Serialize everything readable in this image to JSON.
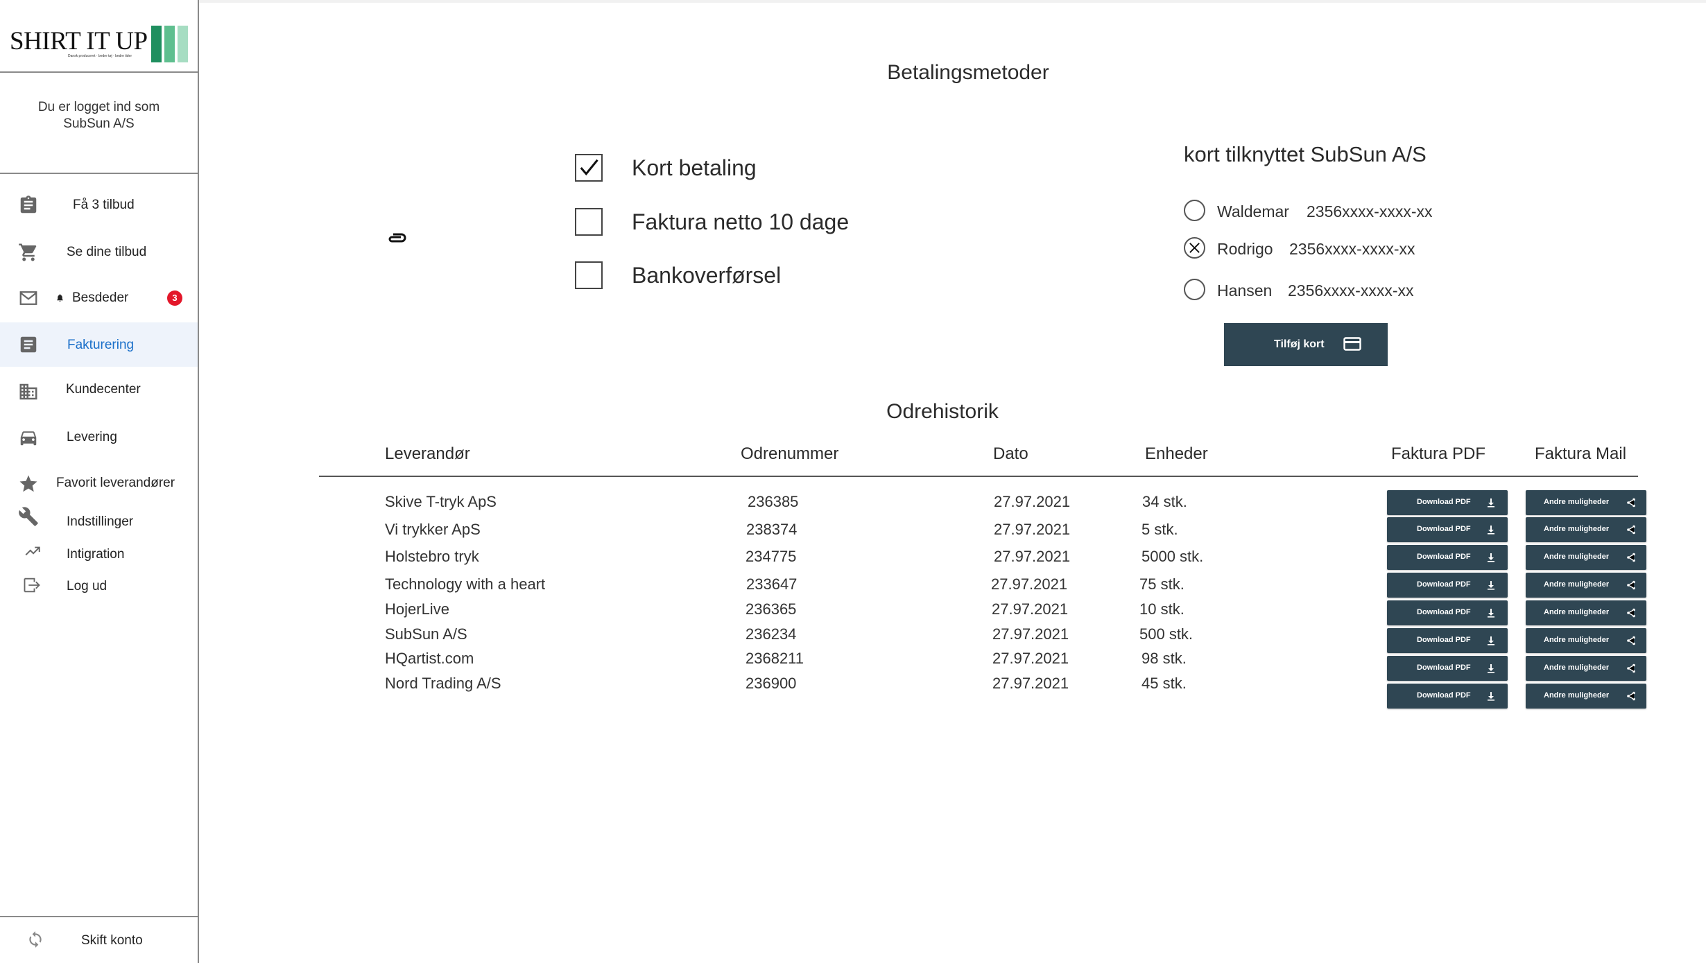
{
  "brand": {
    "name": "SHIRT IT UP",
    "tagline": "Dansk produceret · bedre tøj · bedre tider",
    "colors": [
      "#1f8f5f",
      "#5fbf8f",
      "#a6ddc2"
    ]
  },
  "sidebar": {
    "logged_in_line1": "Du er logget ind som",
    "logged_in_line2": "SubSun A/S",
    "items": [
      {
        "label": "Få 3 tilbud",
        "icon": "clipboard-icon"
      },
      {
        "label": "Se dine tilbud",
        "icon": "cart-icon"
      },
      {
        "label": "Besdeder",
        "icon": "mail-icon",
        "badge": "3"
      },
      {
        "label": "Fakturering",
        "icon": "invoice-icon",
        "active": true
      },
      {
        "label": "Kundecenter",
        "icon": "building-icon"
      },
      {
        "label": "Levering",
        "icon": "car-icon"
      },
      {
        "label": "Favorit leverandører",
        "icon": "star-icon"
      },
      {
        "label": "Indstillinger",
        "icon": "wrench-icon"
      },
      {
        "label": "Intigration",
        "icon": "trending-icon"
      },
      {
        "label": "Log ud",
        "icon": "logout-icon"
      }
    ],
    "switch_account": "Skift konto"
  },
  "payment": {
    "title": "Betalingsmetoder",
    "methods": [
      {
        "label": "Kort betaling",
        "checked": true
      },
      {
        "label": "Faktura netto 10 dage",
        "checked": false
      },
      {
        "label": "Bankoverførsel",
        "checked": false
      }
    ]
  },
  "cards": {
    "title": "kort tilknyttet SubSun A/S",
    "items": [
      {
        "name": "Waldemar",
        "number": "2356xxxx-xxxx-xx",
        "selected": false
      },
      {
        "name": "Rodrigo",
        "number": "2356xxxx-xxxx-xx",
        "selected": true
      },
      {
        "name": "Hansen",
        "number": "2356xxxx-xxxx-xx",
        "selected": false
      }
    ],
    "add_button": "Tilføj kort"
  },
  "orders": {
    "title": "Odrehistorik",
    "columns": [
      "Leverandør",
      "Odrenummer",
      "Dato",
      "Enheder",
      "Faktura PDF",
      "Faktura Mail"
    ],
    "pdf_button": "Download PDF",
    "mail_button": "Andre muligheder",
    "rows": [
      {
        "supplier": "Skive T-tryk ApS",
        "order": "236385",
        "date": "27.97.2021",
        "units": "34 stk."
      },
      {
        "supplier": "Vi trykker ApS",
        "order": "238374",
        "date": "27.97.2021",
        "units": "5 stk."
      },
      {
        "supplier": "Holstebro tryk",
        "order": "234775",
        "date": "27.97.2021",
        "units": "5000 stk."
      },
      {
        "supplier": "Technology with a heart",
        "order": "233647",
        "date": "27.97.2021",
        "units": "75 stk."
      },
      {
        "supplier": "HojerLive",
        "order": "236365",
        "date": "27.97.2021",
        "units": "10 stk."
      },
      {
        "supplier": "SubSun A/S",
        "order": "236234",
        "date": "27.97.2021",
        "units": "500 stk."
      },
      {
        "supplier": "HQartist.com",
        "order": "2368211",
        "date": "27.97.2021",
        "units": "98 stk."
      },
      {
        "supplier": "Nord Trading A/S",
        "order": "236900",
        "date": "27.97.2021",
        "units": "45 stk."
      }
    ]
  }
}
